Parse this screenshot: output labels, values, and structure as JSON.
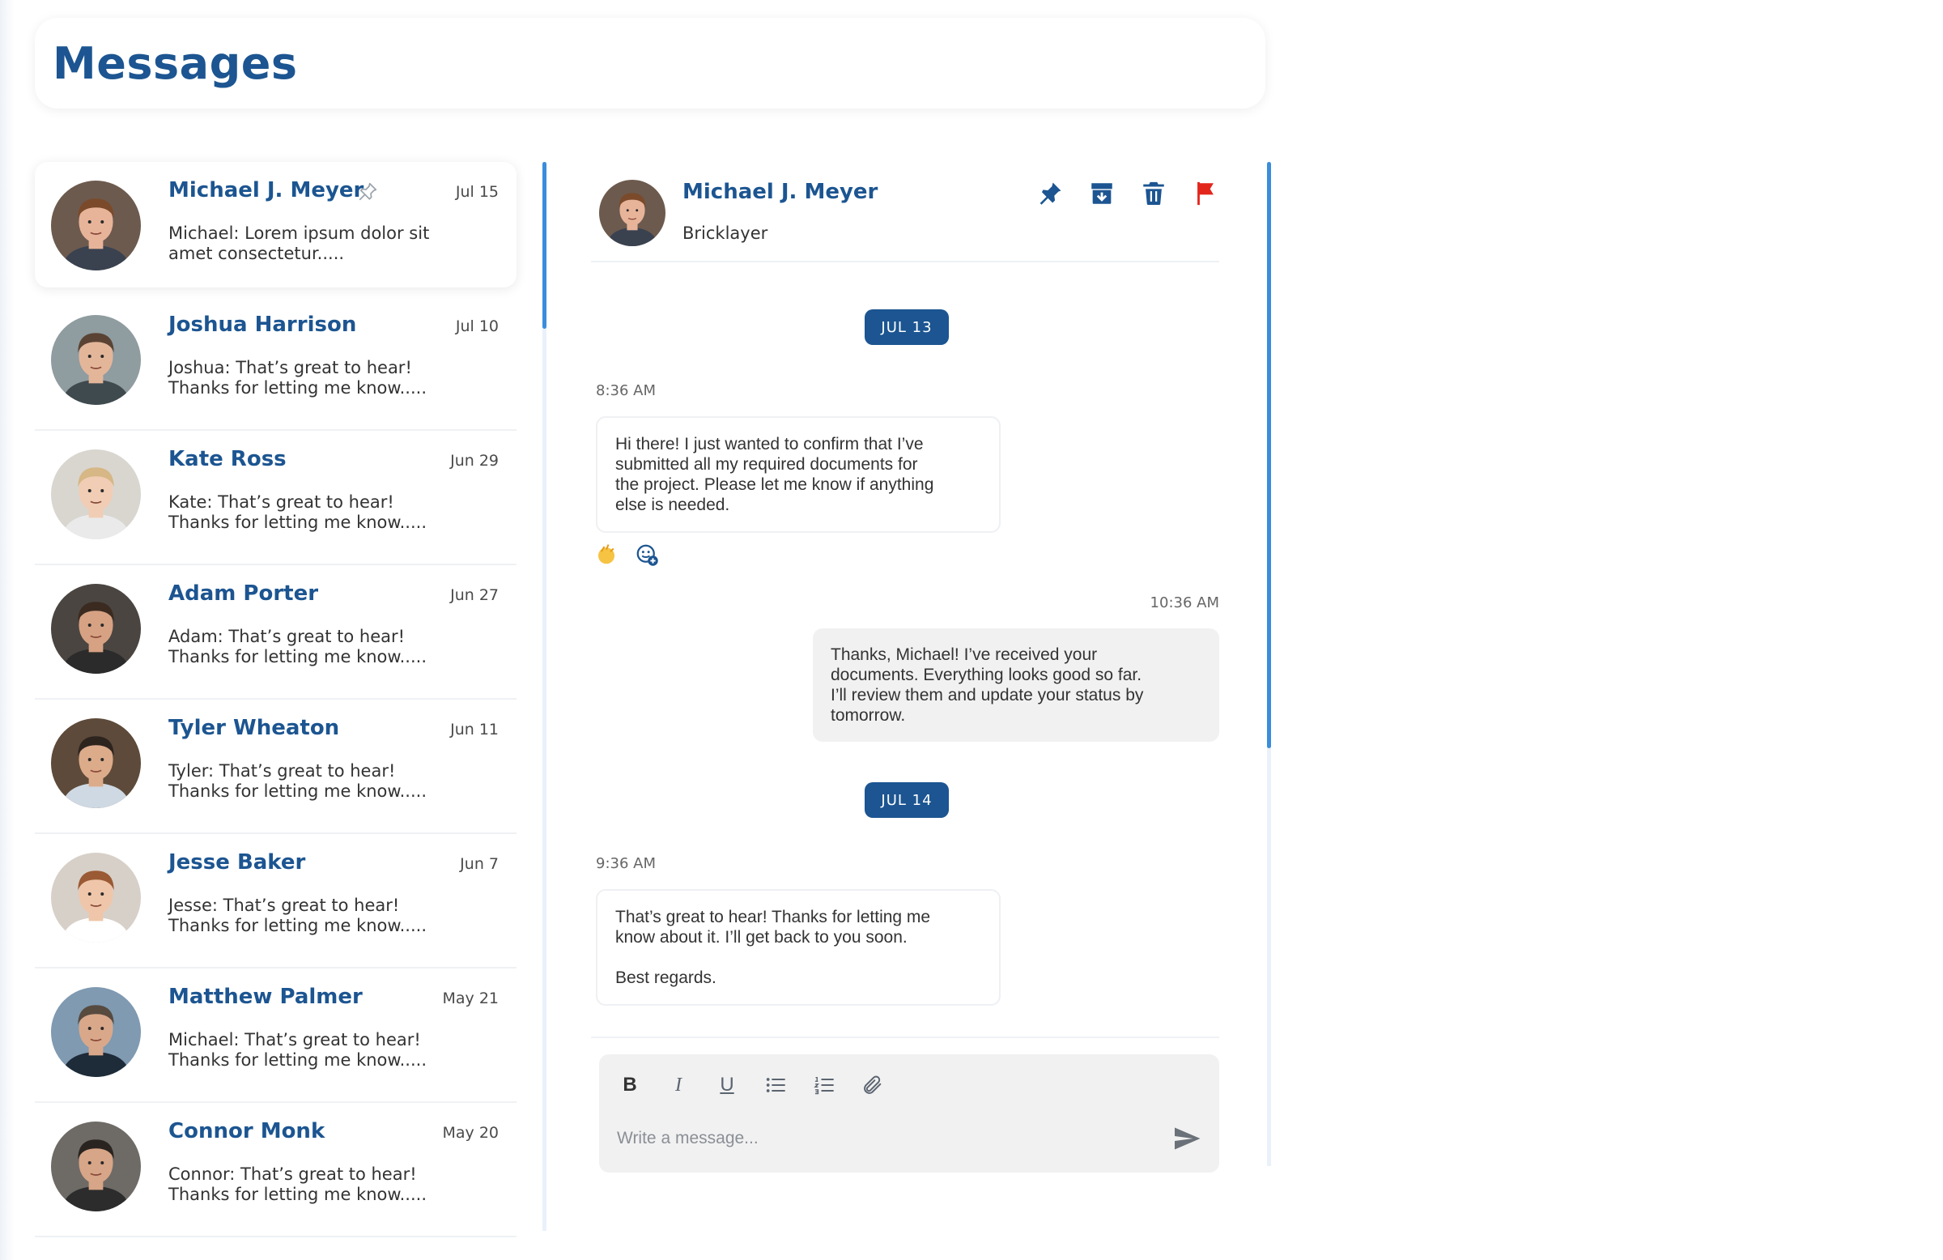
{
  "page": {
    "title": "Messages"
  },
  "colors": {
    "brand": "#1c5591",
    "accent": "#3b8ddb",
    "flag": "#e2261c"
  },
  "conversations": [
    {
      "name": "Michael J. Meyer",
      "date": "Jul 15",
      "preview": "Michael: Lorem ipsum dolor sit\namet consectetur.....",
      "pinned": true,
      "avatar": {
        "skin": "#e7b49a",
        "hair": "#7a4a2a",
        "bg": "#6d5a4e",
        "shirt": "#3a4250"
      }
    },
    {
      "name": "Joshua Harrison",
      "date": "Jul 10",
      "preview": "Joshua: That’s great to hear!\nThanks for letting me know.....",
      "avatar": {
        "skin": "#e3b69a",
        "hair": "#5a4334",
        "bg": "#8f9ca0",
        "shirt": "#3f4a4f"
      }
    },
    {
      "name": "Kate Ross",
      "date": "Jun 29",
      "preview": "Kate: That’s great to hear!\nThanks for letting me know.....",
      "avatar": {
        "skin": "#f0cdb4",
        "hair": "#d6b785",
        "bg": "#d9d6d0",
        "shirt": "#eaeaea"
      }
    },
    {
      "name": "Adam Porter",
      "date": "Jun 27",
      "preview": "Adam: That’s great to hear!\nThanks for letting me know.....",
      "avatar": {
        "skin": "#d6a283",
        "hair": "#3b2a20",
        "bg": "#4a4541",
        "shirt": "#2b2b2b"
      }
    },
    {
      "name": "Tyler Wheaton",
      "date": "Jun 11",
      "preview": "Tyler: That’s great to hear!\nThanks for letting me know.....",
      "avatar": {
        "skin": "#dcab8a",
        "hair": "#2d241e",
        "bg": "#5d4a3a",
        "shirt": "#cfd9e3"
      }
    },
    {
      "name": "Jesse Baker",
      "date": "Jun 7",
      "preview": "Jesse: That’s great to hear!\nThanks for letting me know.....",
      "avatar": {
        "skin": "#efc6aa",
        "hair": "#9a5a33",
        "bg": "#d7d0c8",
        "shirt": "#ffffff"
      }
    },
    {
      "name": "Matthew Palmer",
      "date": "May 21",
      "preview": "Michael: That’s great to hear!\nThanks for letting me know.....",
      "avatar": {
        "skin": "#d9a88a",
        "hair": "#574a3f",
        "bg": "#7f9ab1",
        "shirt": "#1e2b38"
      }
    },
    {
      "name": "Connor Monk",
      "date": "May 20",
      "preview": "Connor: That’s great to hear!\nThanks for letting me know.....",
      "avatar": {
        "skin": "#d7a587",
        "hair": "#2a2420",
        "bg": "#6e6a66",
        "shirt": "#2c2c2c"
      }
    }
  ],
  "chat": {
    "contact_name": "Michael J. Meyer",
    "contact_role": "Bricklayer",
    "actions": [
      "pin-icon",
      "archive-icon",
      "trash-icon",
      "flag-icon"
    ],
    "date1": "JUL 13",
    "msg1_time": "8:36 AM",
    "msg1_text": "Hi there! I just wanted to confirm that I’ve\nsubmitted all my required documents for\nthe project. Please let me know if anything\nelse is needed.",
    "msg1_reactions": [
      "clapping-hands-emoji",
      "add-reaction-icon"
    ],
    "msg2_time": "10:36 AM",
    "msg2_text": "Thanks, Michael! I’ve received your\ndocuments. Everything looks good so far.\nI’ll review them and update your status by\ntomorrow.",
    "date2": "JUL 14",
    "msg3_time": "9:36 AM",
    "msg3_text": "That’s great to hear! Thanks for letting me\nknow about it. I’ll get back to you soon.\n\nBest regards."
  },
  "composer": {
    "tools": [
      "B",
      "I",
      "U",
      "bullet-list-icon",
      "numbered-list-icon",
      "attach-icon"
    ],
    "placeholder": "Write a message..."
  }
}
